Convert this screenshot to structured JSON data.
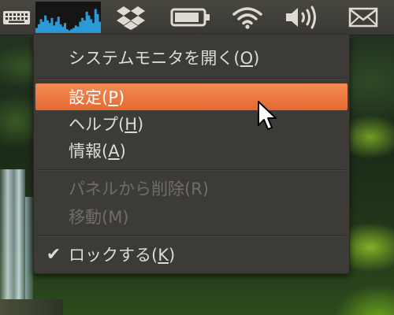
{
  "panel": {
    "indicators": [
      {
        "name": "keyboard-indicator",
        "icon": "keyboard-icon"
      },
      {
        "name": "system-monitor-indicator",
        "icon": "cpu-graph-icon"
      },
      {
        "name": "dropbox-indicator",
        "icon": "dropbox-icon"
      },
      {
        "name": "battery-indicator",
        "icon": "battery-icon"
      },
      {
        "name": "wifi-indicator",
        "icon": "wifi-icon"
      },
      {
        "name": "sound-indicator",
        "icon": "speaker-icon"
      },
      {
        "name": "messaging-indicator",
        "icon": "envelope-icon"
      }
    ],
    "sysmon_bars": [
      4,
      7,
      11,
      9,
      14,
      10,
      8,
      12,
      6,
      9,
      13,
      7,
      5,
      8,
      3,
      2,
      3,
      4,
      6,
      5,
      9,
      12,
      10,
      17,
      14,
      11,
      8,
      19,
      15,
      9
    ]
  },
  "menu": {
    "open_system_monitor": {
      "label": "システムモニタを開く(",
      "mnemonic": "O",
      "suffix": ")"
    },
    "preferences": {
      "label": "設定(",
      "mnemonic": "P",
      "suffix": ")",
      "highlighted": true
    },
    "help": {
      "label": "ヘルプ(",
      "mnemonic": "H",
      "suffix": ")"
    },
    "about": {
      "label": "情報(",
      "mnemonic": "A",
      "suffix": ")"
    },
    "remove_from_panel": {
      "label": "パネルから削除(R)",
      "enabled": false
    },
    "move": {
      "label": "移動(M)",
      "enabled": false
    },
    "lock": {
      "label": "ロックする(",
      "mnemonic": "K",
      "suffix": ")",
      "checked": true,
      "check_mark": "✔"
    }
  },
  "colors": {
    "panel_bg": "#3f3e39",
    "menu_bg": "#3c3b37",
    "highlight": "#ec7640",
    "text": "#dcdad5",
    "disabled_text": "#6f6d66",
    "sysmon_bar": "#2d9ad8"
  }
}
